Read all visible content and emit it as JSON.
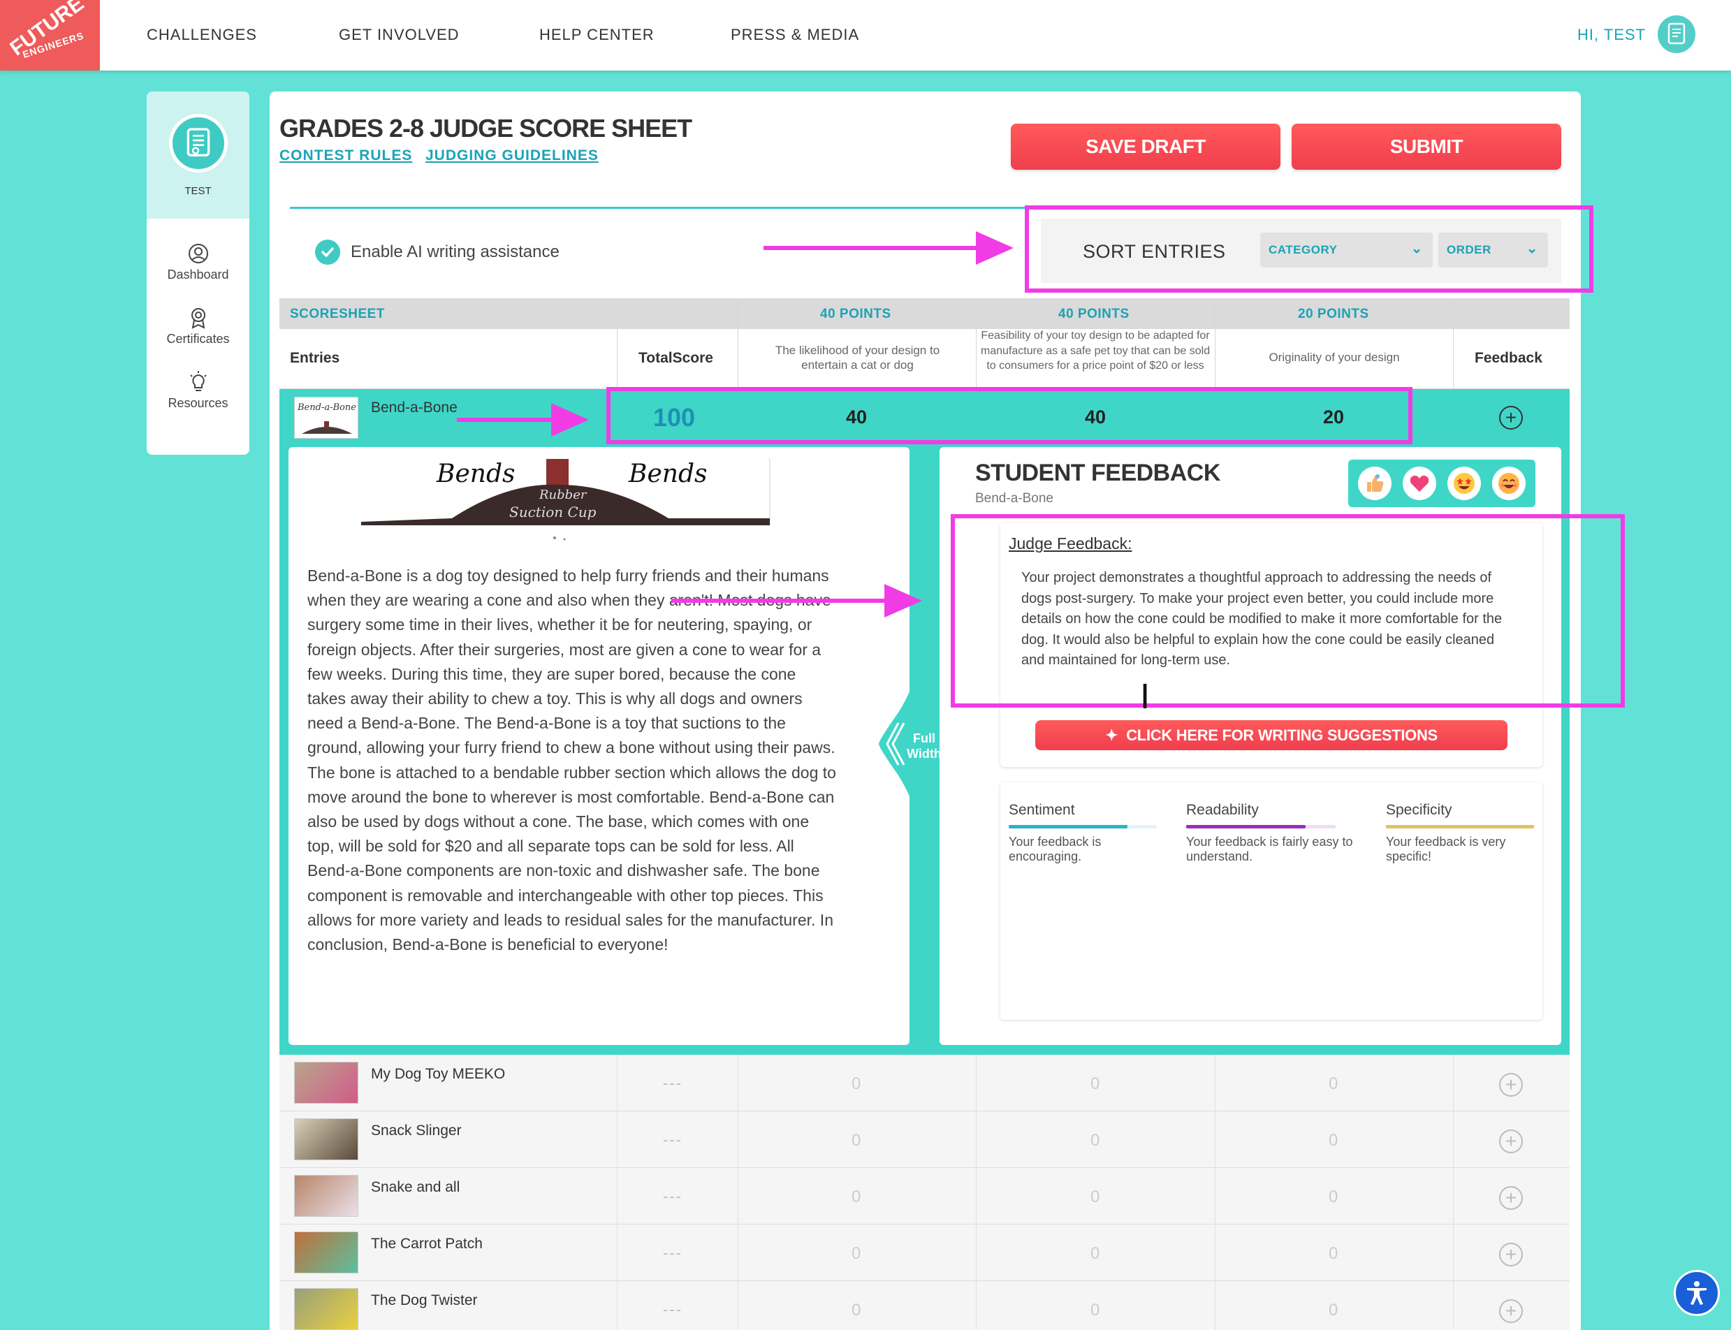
{
  "nav": {
    "logo_line1": "FUTURE",
    "logo_line2": "ENGINEERS",
    "items": [
      "CHALLENGES",
      "GET INVOLVED",
      "HELP CENTER",
      "PRESS & MEDIA"
    ],
    "greeting": "HI, TEST"
  },
  "sidebar": {
    "user": "TEST",
    "items": [
      {
        "label": "Dashboard",
        "icon": "user-circle-icon"
      },
      {
        "label": "Certificates",
        "icon": "award-icon"
      },
      {
        "label": "Resources",
        "icon": "lightbulb-icon"
      }
    ]
  },
  "header": {
    "title": "GRADES 2-8 JUDGE SCORE SHEET",
    "link_rules": "CONTEST RULES",
    "link_guidelines": "JUDGING GUIDELINES",
    "save_draft": "SAVE DRAFT",
    "submit": "SUBMIT"
  },
  "ai": {
    "label": "Enable AI writing assistance",
    "checked": true
  },
  "sort": {
    "label": "SORT ENTRIES",
    "category": "CATEGORY",
    "order": "ORDER"
  },
  "table": {
    "scoresheet": "SCORESHEET",
    "points": [
      "40 POINTS",
      "40 POINTS",
      "20 POINTS"
    ],
    "col_entries": "Entries",
    "col_total": "TotalScore",
    "criteria": [
      "The likelihood of your design to entertain a cat or dog",
      "Feasibility of your toy design to be adapted for manufacture as a safe pet toy that can be sold to consumers for a price point of $20 or less",
      "Originality of your design"
    ],
    "col_feedback": "Feedback"
  },
  "active_entry": {
    "name": "Bend-a-Bone",
    "total": "100",
    "scores": [
      "40",
      "40",
      "20"
    ],
    "drawing_text": [
      "Bends",
      "Bends",
      "Rubber",
      "Suction Cup"
    ],
    "essay": "Bend-a-Bone is a dog toy designed to help furry friends and their humans when they are wearing a cone and also when they aren't! Most dogs have surgery some time in their lives, whether it be for neutering, spaying, or foreign objects. After their surgeries, most are given a cone to wear for a few weeks. During this time, they are super bored, because the cone takes away their ability to chew a toy. This is why all dogs and owners need a Bend-a-Bone. The Bend-a-Bone is a toy that suctions to the ground, allowing your furry friend to chew a bone without using their paws. The bone is attached to a bendable rubber section which allows the dog to move around the bone to wherever is most comfortable. Bend-a-Bone can also be used by dogs without a cone. The base, which comes with one top, will be sold for $20 and all separate tops can be sold for less. All Bend-a-Bone components are non-toxic and dishwasher safe. The bone component is removable and interchangeable with other top pieces. This allows for more variety and leads to residual sales for the manufacturer. In conclusion, Bend-a-Bone is beneficial to everyone!",
    "full_width": "Full Width"
  },
  "feedback": {
    "title": "STUDENT FEEDBACK",
    "subtitle": "Bend-a-Bone",
    "emojis": [
      "thumbs-up-icon",
      "heart-icon",
      "star-eyes-icon",
      "smile-icon"
    ],
    "judge_label": "Judge Feedback:",
    "judge_text": "Your project demonstrates a thoughtful approach to addressing the needs of dogs post-surgery. To make your project even better, you could include more details on how the cone could be modified to make it more comfortable for the dog. It would also be helpful to explain how the cone could be easily cleaned and maintained for long-term use.",
    "suggest_button": "CLICK HERE FOR WRITING SUGGESTIONS",
    "metrics": [
      {
        "label": "Sentiment",
        "text": "Your feedback is encouraging.",
        "color": "#2bb3c8",
        "level": 0.8
      },
      {
        "label": "Readability",
        "text": "Your feedback is fairly easy to understand.",
        "color": "#9b2fc2",
        "level": 0.8
      },
      {
        "label": "Specificity",
        "text": "Your feedback is very specific!",
        "color": "#e3c060",
        "level": 1.0
      }
    ]
  },
  "entries": [
    {
      "name": "My Dog Toy MEEKO",
      "total": "---",
      "scores": [
        "0",
        "0",
        "0"
      ]
    },
    {
      "name": "Snack Slinger",
      "total": "---",
      "scores": [
        "0",
        "0",
        "0"
      ]
    },
    {
      "name": "Snake and all",
      "total": "---",
      "scores": [
        "0",
        "0",
        "0"
      ]
    },
    {
      "name": "The Carrot Patch",
      "total": "---",
      "scores": [
        "0",
        "0",
        "0"
      ]
    },
    {
      "name": "The Dog Twister",
      "total": "---",
      "scores": [
        "0",
        "0",
        "0"
      ]
    }
  ],
  "colors": {
    "teal": "#3fd6c8",
    "background": "#62e2d6",
    "red": "#f03e4e",
    "link": "#1aa3b5",
    "annotation": "#f13ce6"
  }
}
